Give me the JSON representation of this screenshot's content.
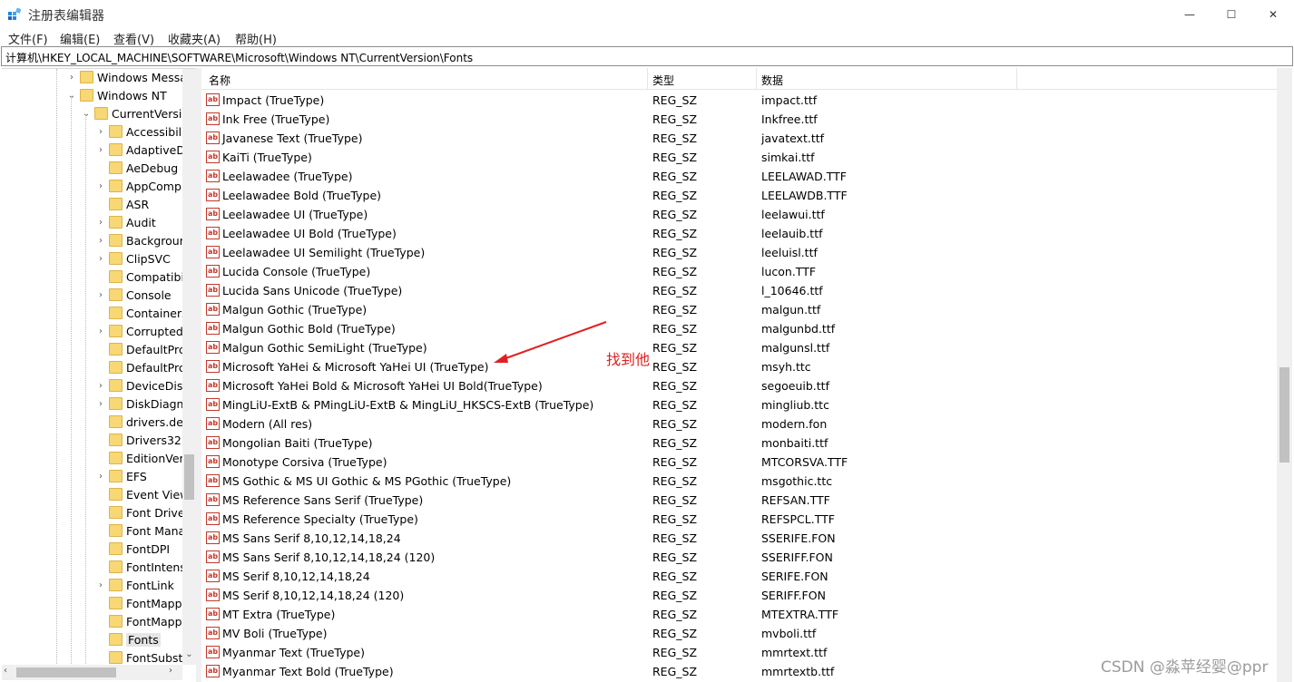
{
  "window": {
    "title": "注册表编辑器",
    "minimize_glyph": "—",
    "maximize_glyph": "☐",
    "close_glyph": "✕"
  },
  "menu": {
    "file": "文件(F)",
    "edit": "编辑(E)",
    "view": "查看(V)",
    "favorites": "收藏夹(A)",
    "help": "帮助(H)"
  },
  "address": "计算机\\HKEY_LOCAL_MACHINE\\SOFTWARE\\Microsoft\\Windows NT\\CurrentVersion\\Fonts",
  "tree": {
    "items": [
      {
        "label": "Windows Messa",
        "level": 0,
        "expander": "›"
      },
      {
        "label": "Windows NT",
        "level": 0,
        "expander": "⌄"
      },
      {
        "label": "CurrentVersio",
        "level": 1,
        "expander": "⌄"
      },
      {
        "label": "Accessibili",
        "level": 2,
        "expander": "›"
      },
      {
        "label": "AdaptiveD",
        "level": 2,
        "expander": "›"
      },
      {
        "label": "AeDebug",
        "level": 2,
        "expander": ""
      },
      {
        "label": "AppComp",
        "level": 2,
        "expander": "›"
      },
      {
        "label": "ASR",
        "level": 2,
        "expander": ""
      },
      {
        "label": "Audit",
        "level": 2,
        "expander": "›"
      },
      {
        "label": "Backgrour",
        "level": 2,
        "expander": "›"
      },
      {
        "label": "ClipSVC",
        "level": 2,
        "expander": "›"
      },
      {
        "label": "Compatibi",
        "level": 2,
        "expander": ""
      },
      {
        "label": "Console",
        "level": 2,
        "expander": "›"
      },
      {
        "label": "Containers",
        "level": 2,
        "expander": ""
      },
      {
        "label": "Corrupted",
        "level": 2,
        "expander": "›"
      },
      {
        "label": "DefaultPrc",
        "level": 2,
        "expander": ""
      },
      {
        "label": "DefaultPrc",
        "level": 2,
        "expander": ""
      },
      {
        "label": "DeviceDisp",
        "level": 2,
        "expander": "›"
      },
      {
        "label": "DiskDiagn",
        "level": 2,
        "expander": "›"
      },
      {
        "label": "drivers.de",
        "level": 2,
        "expander": ""
      },
      {
        "label": "Drivers32",
        "level": 2,
        "expander": ""
      },
      {
        "label": "EditionVer",
        "level": 2,
        "expander": ""
      },
      {
        "label": "EFS",
        "level": 2,
        "expander": "›"
      },
      {
        "label": "Event View",
        "level": 2,
        "expander": ""
      },
      {
        "label": "Font Drive",
        "level": 2,
        "expander": ""
      },
      {
        "label": "Font Mana",
        "level": 2,
        "expander": ""
      },
      {
        "label": "FontDPI",
        "level": 2,
        "expander": ""
      },
      {
        "label": "FontIntens",
        "level": 2,
        "expander": ""
      },
      {
        "label": "FontLink",
        "level": 2,
        "expander": "›"
      },
      {
        "label": "FontMapp",
        "level": 2,
        "expander": ""
      },
      {
        "label": "FontMapp",
        "level": 2,
        "expander": ""
      },
      {
        "label": "Fonts",
        "level": 2,
        "expander": "",
        "selected": true
      },
      {
        "label": "FontSubsti",
        "level": 2,
        "expander": ""
      }
    ],
    "scroll_left": "‹",
    "scroll_right": "›",
    "scroll_down": "⌄"
  },
  "list": {
    "headers": {
      "name": "名称",
      "type": "类型",
      "data": "数据"
    },
    "icon_text": "ab",
    "rows": [
      {
        "name": "Impact (TrueType)",
        "type": "REG_SZ",
        "data": "impact.ttf"
      },
      {
        "name": "Ink Free (TrueType)",
        "type": "REG_SZ",
        "data": "Inkfree.ttf"
      },
      {
        "name": "Javanese Text (TrueType)",
        "type": "REG_SZ",
        "data": "javatext.ttf"
      },
      {
        "name": "KaiTi (TrueType)",
        "type": "REG_SZ",
        "data": "simkai.ttf"
      },
      {
        "name": "Leelawadee (TrueType)",
        "type": "REG_SZ",
        "data": "LEELAWAD.TTF"
      },
      {
        "name": "Leelawadee Bold (TrueType)",
        "type": "REG_SZ",
        "data": "LEELAWDB.TTF"
      },
      {
        "name": "Leelawadee UI (TrueType)",
        "type": "REG_SZ",
        "data": "leelawui.ttf"
      },
      {
        "name": "Leelawadee UI Bold (TrueType)",
        "type": "REG_SZ",
        "data": "leelauib.ttf"
      },
      {
        "name": "Leelawadee UI Semilight (TrueType)",
        "type": "REG_SZ",
        "data": "leeluisl.ttf"
      },
      {
        "name": "Lucida Console (TrueType)",
        "type": "REG_SZ",
        "data": "lucon.TTF"
      },
      {
        "name": "Lucida Sans Unicode (TrueType)",
        "type": "REG_SZ",
        "data": "l_10646.ttf"
      },
      {
        "name": "Malgun Gothic (TrueType)",
        "type": "REG_SZ",
        "data": "malgun.ttf"
      },
      {
        "name": "Malgun Gothic Bold (TrueType)",
        "type": "REG_SZ",
        "data": "malgunbd.ttf"
      },
      {
        "name": "Malgun Gothic SemiLight (TrueType)",
        "type": "REG_SZ",
        "data": "malgunsl.ttf"
      },
      {
        "name": "Microsoft YaHei & Microsoft YaHei UI (TrueType)",
        "type": "REG_SZ",
        "data": "msyh.ttc"
      },
      {
        "name": "Microsoft YaHei Bold & Microsoft YaHei UI Bold(TrueType)",
        "type": "REG_SZ",
        "data": "segoeuib.ttf"
      },
      {
        "name": "MingLiU-ExtB & PMingLiU-ExtB & MingLiU_HKSCS-ExtB (TrueType)",
        "type": "REG_SZ",
        "data": "mingliub.ttc"
      },
      {
        "name": "Modern (All res)",
        "type": "REG_SZ",
        "data": "modern.fon"
      },
      {
        "name": "Mongolian Baiti (TrueType)",
        "type": "REG_SZ",
        "data": "monbaiti.ttf"
      },
      {
        "name": "Monotype Corsiva (TrueType)",
        "type": "REG_SZ",
        "data": "MTCORSVA.TTF"
      },
      {
        "name": "MS Gothic & MS UI Gothic & MS PGothic (TrueType)",
        "type": "REG_SZ",
        "data": "msgothic.ttc"
      },
      {
        "name": "MS Reference Sans Serif (TrueType)",
        "type": "REG_SZ",
        "data": "REFSAN.TTF"
      },
      {
        "name": "MS Reference Specialty (TrueType)",
        "type": "REG_SZ",
        "data": "REFSPCL.TTF"
      },
      {
        "name": "MS Sans Serif 8,10,12,14,18,24",
        "type": "REG_SZ",
        "data": "SSERIFE.FON"
      },
      {
        "name": "MS Sans Serif 8,10,12,14,18,24 (120)",
        "type": "REG_SZ",
        "data": "SSERIFF.FON"
      },
      {
        "name": "MS Serif 8,10,12,14,18,24",
        "type": "REG_SZ",
        "data": "SERIFE.FON"
      },
      {
        "name": "MS Serif 8,10,12,14,18,24 (120)",
        "type": "REG_SZ",
        "data": "SERIFF.FON"
      },
      {
        "name": "MT Extra (TrueType)",
        "type": "REG_SZ",
        "data": "MTEXTRA.TTF"
      },
      {
        "name": "MV Boli (TrueType)",
        "type": "REG_SZ",
        "data": "mvboli.ttf"
      },
      {
        "name": "Myanmar Text (TrueType)",
        "type": "REG_SZ",
        "data": "mmrtext.ttf"
      },
      {
        "name": "Myanmar Text Bold (TrueType)",
        "type": "REG_SZ",
        "data": "mmrtextb.ttf"
      }
    ]
  },
  "annotation": {
    "text": "找到他",
    "color": "#e02020"
  },
  "watermark": "CSDN @淼苹经婴@ppr",
  "colors": {
    "folder": "#f8d775",
    "value_icon": "#c0392b",
    "selected": "#e5e5e5"
  }
}
